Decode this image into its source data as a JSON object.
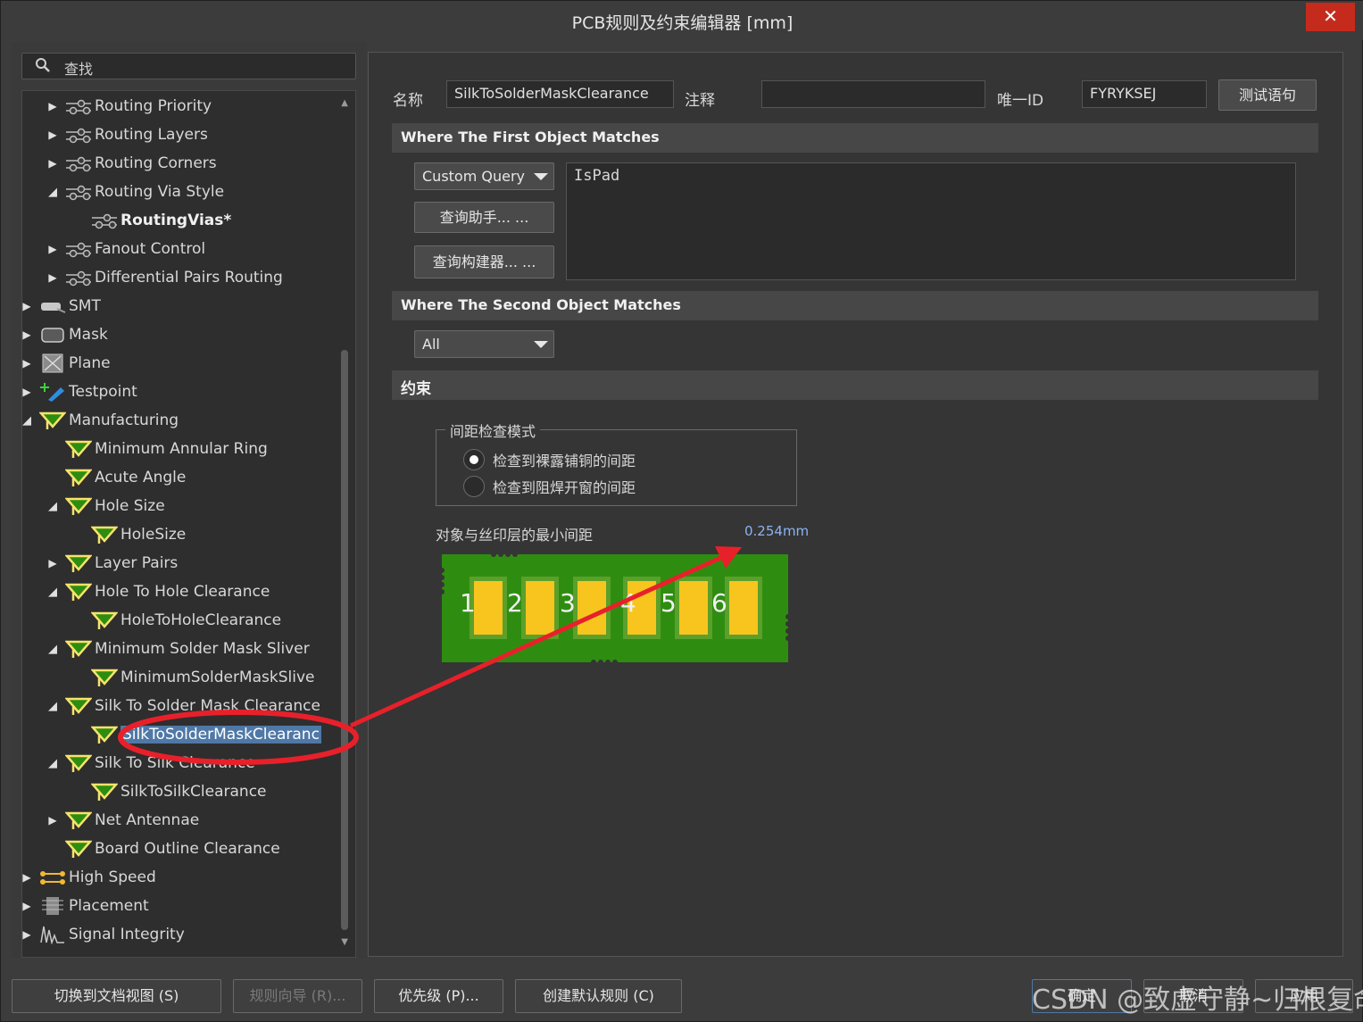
{
  "window": {
    "title": "PCB规则及约束编辑器 [mm]",
    "close_glyph": "✕"
  },
  "search": {
    "placeholder": "查找"
  },
  "tree": [
    {
      "label": "Routing Priority",
      "arrow": "▶",
      "icon": "routing-icon"
    },
    {
      "label": "Routing Layers",
      "arrow": "▶",
      "icon": "routing-icon"
    },
    {
      "label": "Routing Corners",
      "arrow": "▶",
      "icon": "routing-icon"
    },
    {
      "label": "Routing Via Style",
      "arrow": "◢",
      "icon": "routing-icon"
    },
    {
      "label": "RoutingVias*",
      "arrow": "",
      "icon": "routing-icon",
      "bold": true
    },
    {
      "label": "Fanout Control",
      "arrow": "▶",
      "icon": "routing-icon"
    },
    {
      "label": "Differential Pairs Routing",
      "arrow": "▶",
      "icon": "routing-icon"
    },
    {
      "label": "SMT",
      "arrow": "▶",
      "icon": "smt-icon"
    },
    {
      "label": "Mask",
      "arrow": "▶",
      "icon": "mask-icon"
    },
    {
      "label": "Plane",
      "arrow": "▶",
      "icon": "plane-icon"
    },
    {
      "label": "Testpoint",
      "arrow": "▶",
      "icon": "testpoint-icon"
    },
    {
      "label": "Manufacturing",
      "arrow": "◢",
      "icon": "manufacturing-icon"
    },
    {
      "label": "Minimum Annular Ring",
      "arrow": "",
      "icon": "manufacturing-icon"
    },
    {
      "label": "Acute Angle",
      "arrow": "",
      "icon": "manufacturing-icon"
    },
    {
      "label": "Hole Size",
      "arrow": "◢",
      "icon": "manufacturing-icon"
    },
    {
      "label": "HoleSize",
      "arrow": "",
      "icon": "manufacturing-icon"
    },
    {
      "label": "Layer Pairs",
      "arrow": "▶",
      "icon": "manufacturing-icon"
    },
    {
      "label": "Hole To Hole Clearance",
      "arrow": "◢",
      "icon": "manufacturing-icon"
    },
    {
      "label": "HoleToHoleClearance",
      "arrow": "",
      "icon": "manufacturing-icon"
    },
    {
      "label": "Minimum Solder Mask Sliver",
      "arrow": "◢",
      "icon": "manufacturing-icon"
    },
    {
      "label": "MinimumSolderMaskSlive",
      "arrow": "",
      "icon": "manufacturing-icon"
    },
    {
      "label": "Silk To Solder Mask Clearance",
      "arrow": "◢",
      "icon": "manufacturing-icon"
    },
    {
      "label": "SilkToSolderMaskClearanc",
      "arrow": "",
      "icon": "manufacturing-icon",
      "selected": true
    },
    {
      "label": "Silk To Silk Clearance",
      "arrow": "◢",
      "icon": "manufacturing-icon"
    },
    {
      "label": "SilkToSilkClearance",
      "arrow": "",
      "icon": "manufacturing-icon"
    },
    {
      "label": "Net Antennae",
      "arrow": "▶",
      "icon": "manufacturing-icon"
    },
    {
      "label": "Board Outline Clearance",
      "arrow": "",
      "icon": "manufacturing-icon"
    },
    {
      "label": "High Speed",
      "arrow": "▶",
      "icon": "highspeed-icon"
    },
    {
      "label": "Placement",
      "arrow": "▶",
      "icon": "placement-icon"
    },
    {
      "label": "Signal Integrity",
      "arrow": "▶",
      "icon": "signal-integrity-icon"
    }
  ],
  "rule": {
    "name_label": "名称",
    "name_value": "SilkToSolderMaskClearance",
    "comment_label": "注释",
    "comment_value": "",
    "uid_label": "唯一ID",
    "uid_value": "FYRYKSEJ",
    "test_button": "测试语句"
  },
  "first_match": {
    "header": "Where The First Object Matches",
    "dropdown": "Custom Query",
    "query_helper": "查询助手... ...",
    "query_builder": "查询构建器... ...",
    "query_text": "IsPad"
  },
  "second_match": {
    "header": "Where The Second Object Matches",
    "dropdown": "All"
  },
  "constraints": {
    "header": "约束",
    "mode_legend": "间距检查模式",
    "option1": "检查到裸露铺铜的间距",
    "option2": "检查到阻焊开窗的间距",
    "option1_checked": true,
    "min_clearance_label": "对象与丝印层的最小间距",
    "min_clearance_value": "0.254mm",
    "pad_numbers": [
      "1",
      "2",
      "3",
      "4",
      "5",
      "6"
    ]
  },
  "buttons": {
    "switch_view": "切换到文档视图 (S)",
    "rule_wizard": "规则向导 (R)...",
    "priority": "优先级 (P)...",
    "create_default": "创建默认规则 (C)",
    "ok": "确定",
    "cancel": "取消",
    "apply": "应用"
  },
  "watermark": "CSDN @致虚守静~归根复命",
  "colors": {
    "annotation_red": "#e8202a",
    "pcb_green": "#2e8d10",
    "pad_yellow": "#f7c51e",
    "selection_blue": "#4f78a6"
  }
}
